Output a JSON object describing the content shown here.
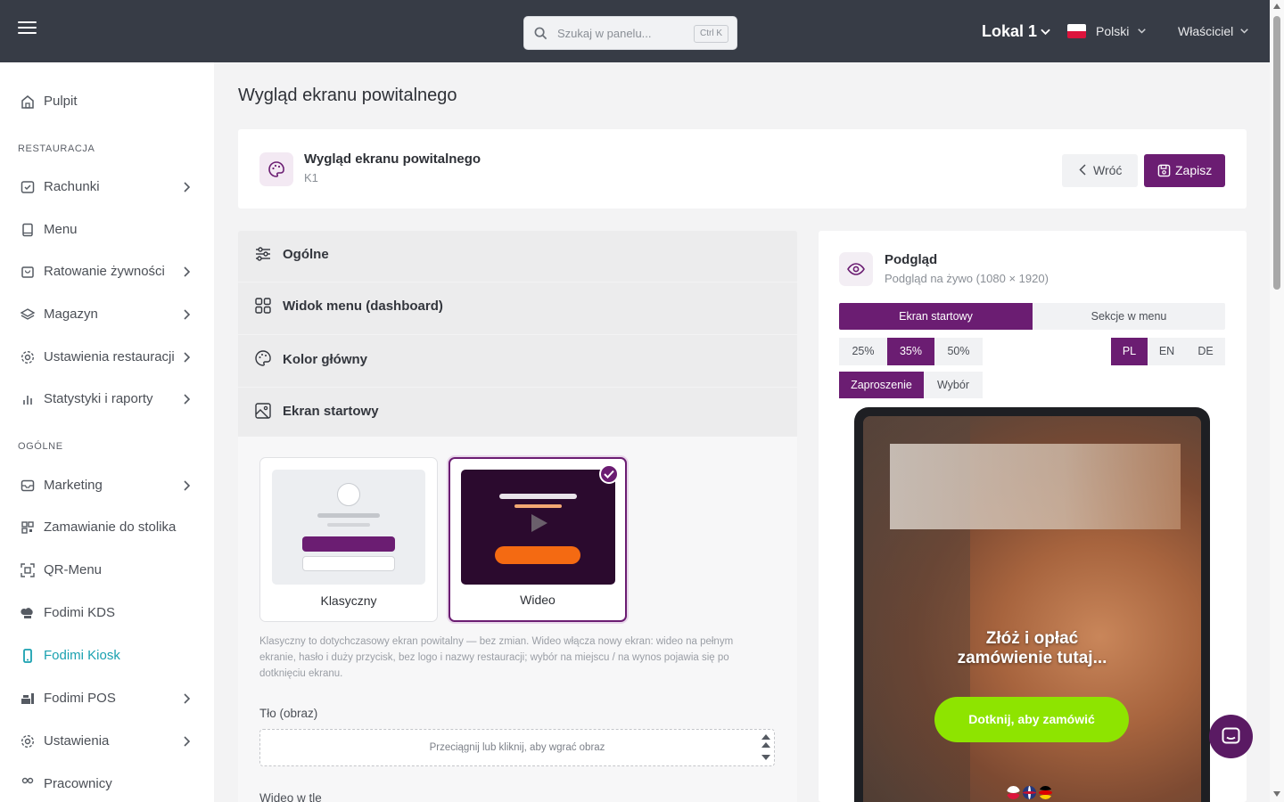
{
  "topbar": {
    "search_placeholder": "Szukaj w panelu...",
    "search_shortcut": "Ctrl K",
    "location": "Lokal 1",
    "language": "Polski",
    "role": "Właściciel"
  },
  "sidebar": {
    "items_top": [
      {
        "label": "Pulpit",
        "icon": "home-icon"
      }
    ],
    "section_restaurant": "RESTAURACJA",
    "restaurant_items": [
      {
        "label": "Rachunki",
        "icon": "receipt-check-icon",
        "has_submenu": true
      },
      {
        "label": "Menu",
        "icon": "book-icon",
        "has_submenu": false
      },
      {
        "label": "Ratowanie żywności",
        "icon": "bag-icon",
        "has_submenu": true
      },
      {
        "label": "Magazyn",
        "icon": "layers-icon",
        "has_submenu": true
      },
      {
        "label": "Ustawienia restauracji",
        "icon": "gear-icon",
        "has_submenu": true
      },
      {
        "label": "Statystyki i raporty",
        "icon": "bar-chart-icon",
        "has_submenu": true
      }
    ],
    "section_general": "OGÓLNE",
    "general_items": [
      {
        "label": "Marketing",
        "icon": "inbox-icon",
        "has_submenu": true
      },
      {
        "label": "Zamawianie do stolika",
        "icon": "qr-small-icon",
        "has_submenu": false
      },
      {
        "label": "QR-Menu",
        "icon": "qr-icon",
        "has_submenu": false
      },
      {
        "label": "Fodimi KDS",
        "icon": "chef-hat-icon",
        "has_submenu": false
      },
      {
        "label": "Fodimi Kiosk",
        "icon": "kiosk-icon",
        "has_submenu": false,
        "active": true
      },
      {
        "label": "Fodimi POS",
        "icon": "pos-icon",
        "has_submenu": true
      },
      {
        "label": "Ustawienia",
        "icon": "gear-icon",
        "has_submenu": true
      },
      {
        "label": "Pracownicy",
        "icon": "users-icon",
        "has_submenu": false
      }
    ],
    "active_color": "#1aa1b0"
  },
  "page": {
    "title": "Wygląd ekranu powitalnego",
    "header_card": {
      "title": "Wygląd ekranu powitalnego",
      "subtitle": "K1",
      "back_label": "Wróć",
      "save_label": "Zapisz"
    },
    "sections": [
      {
        "label": "Ogólne",
        "icon": "sliders-icon"
      },
      {
        "label": "Widok menu (dashboard)",
        "icon": "grid-icon"
      },
      {
        "label": "Kolor główny",
        "icon": "palette-icon"
      },
      {
        "label": "Ekran startowy",
        "icon": "image-icon"
      }
    ],
    "layout_options": [
      {
        "label": "Klasyczny",
        "selected": false
      },
      {
        "label": "Wideo",
        "selected": true
      }
    ],
    "description": "Klasyczny to dotychczasowy ekran powitalny — bez zmian. Wideo włącza nowy ekran: wideo na pełnym ekranie, hasło i duży przycisk, bez logo i nazwy restauracji; wybór na miejscu / na wynos pojawia się po dotknięciu ekranu.",
    "bg_image_label": "Tło (obraz)",
    "bg_image_drop": "Przeciągnij lub kliknij, aby wgrać obraz",
    "bg_video_label": "Wideo w tle",
    "accent": "#6b1d72"
  },
  "preview": {
    "title": "Podgląd",
    "subtitle": "Podgląd na żywo (1080 × 1920)",
    "tabs": [
      {
        "label": "Ekran startowy",
        "active": true
      },
      {
        "label": "Sekcje w menu",
        "active": false
      }
    ],
    "zoom": [
      {
        "label": "25%",
        "active": false
      },
      {
        "label": "35%",
        "active": true
      },
      {
        "label": "50%",
        "active": false
      }
    ],
    "languages": [
      {
        "label": "PL",
        "active": true
      },
      {
        "label": "EN",
        "active": false
      },
      {
        "label": "DE",
        "active": false
      }
    ],
    "modes": [
      {
        "label": "Zaproszenie",
        "active": true
      },
      {
        "label": "Wybór",
        "active": false
      }
    ],
    "screen_headline": "Złóż i opłać zamówienie tutaj...",
    "screen_cta": "Dotknij, aby zamówić",
    "cta_color": "#8ee400"
  }
}
